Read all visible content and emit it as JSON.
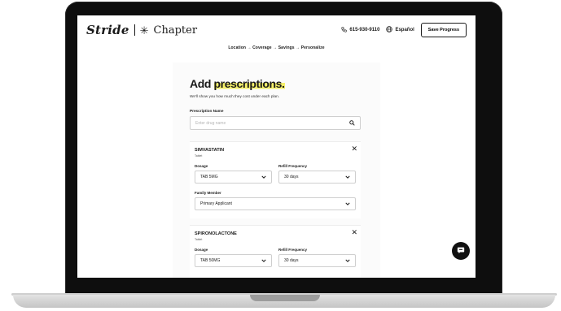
{
  "header": {
    "logo_primary": "Stride",
    "logo_secondary": "Chapter",
    "phone": "615-930-9110",
    "language": "Español",
    "save_label": "Save Progress"
  },
  "breadcrumb": "Location → Coverage → Savings → Personalize",
  "page": {
    "title_plain": "Add ",
    "title_highlight": "prescriptions.",
    "subtitle": "We'll show you how much they cost under each plan.",
    "rx_label": "Prescription Name",
    "search_placeholder": "Enter drug name"
  },
  "labels": {
    "dosage": "Dosage",
    "refill": "Refill Frequency",
    "family": "Family Member"
  },
  "drugs": [
    {
      "name": "SIMVASTATIN",
      "form": "Tablet",
      "dosage": "TAB 5MG",
      "refill": "30 days",
      "family": "Primary Applicant"
    },
    {
      "name": "SPIRONOLACTONE",
      "form": "Tablet",
      "dosage": "TAB 50MG",
      "refill": "30 days"
    }
  ],
  "colors": {
    "highlight": "#f4ef6a",
    "ink": "#1a1a1a"
  }
}
